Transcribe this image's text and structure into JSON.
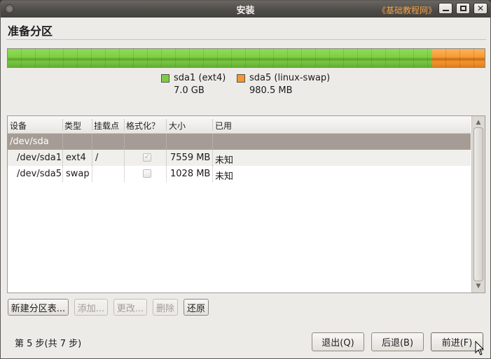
{
  "window": {
    "title": "安装",
    "watermark": "《基础教程网》"
  },
  "heading": "准备分区",
  "partition_bar": {
    "segments": [
      {
        "name": "sda1 (ext4)",
        "size": "7.0 GB",
        "color": "#7ccc43",
        "fraction": 0.887
      },
      {
        "name": "sda5 (linux-swap)",
        "size": "980.5 MB",
        "color": "#f5962f",
        "fraction": 0.113
      }
    ]
  },
  "table": {
    "headers": [
      "设备",
      "类型",
      "挂载点",
      "格式化？",
      "大小",
      "已用"
    ],
    "disk_row": {
      "device": "/dev/sda"
    },
    "rows": [
      {
        "device": "/dev/sda1",
        "type": "ext4",
        "mount": "/",
        "format": true,
        "size": "7559 MB",
        "used": "未知"
      },
      {
        "device": "/dev/sda5",
        "type": "swap",
        "mount": "",
        "format": false,
        "size": "1028 MB",
        "used": "未知"
      }
    ]
  },
  "buttons": {
    "new_table": "新建分区表...",
    "add": "添加...",
    "change": "更改...",
    "delete": "删除",
    "revert": "还原",
    "quit": "退出(Q)",
    "back": "后退(B)",
    "forward": "前进(F)"
  },
  "step": "第 5 步(共 7 步)"
}
